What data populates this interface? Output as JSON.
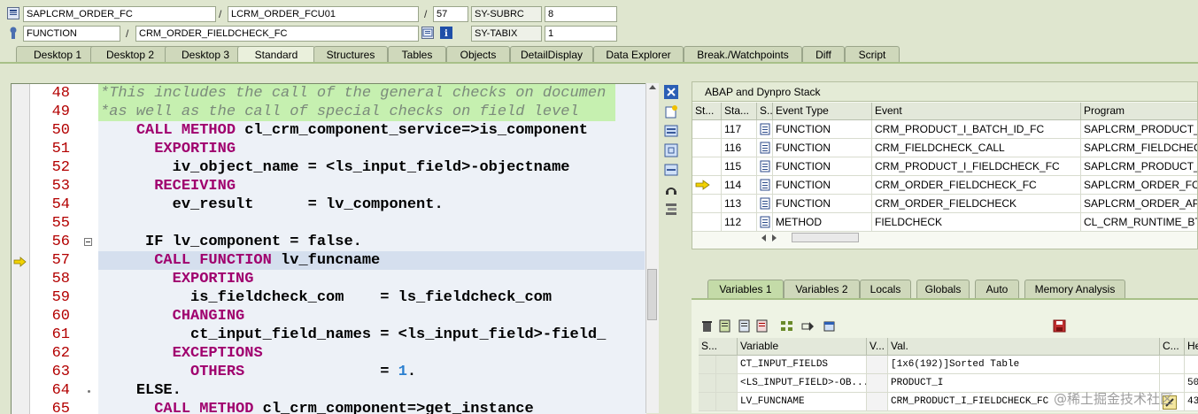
{
  "header": {
    "program": "SAPLCRM_ORDER_FC",
    "include": "LCRM_ORDER_FCU01",
    "line": "57",
    "subrc_label": "SY-SUBRC",
    "subrc_value": "8",
    "event_type": "FUNCTION",
    "event": "CRM_ORDER_FIELDCHECK_FC",
    "tabix_label": "SY-TABIX",
    "tabix_value": "1",
    "sep": "/"
  },
  "tabs": [
    "Desktop 1",
    "Desktop 2",
    "Desktop 3",
    "Standard",
    "Structures",
    "Tables",
    "Objects",
    "DetailDisplay",
    "Data Explorer",
    "Break./Watchpoints",
    "Diff",
    "Script"
  ],
  "code": {
    "lines": [
      {
        "n": "48",
        "parts": [
          [
            "cmt",
            "*This includes the call of the general checks on documen"
          ]
        ]
      },
      {
        "n": "49",
        "parts": [
          [
            "cmt",
            "*as well as the call of special checks on field level"
          ]
        ]
      },
      {
        "n": "50",
        "parts": [
          [
            "tx",
            "    "
          ],
          [
            "kw",
            "CALL METHOD"
          ],
          [
            "tx",
            " cl_crm_component_service=>is_component"
          ]
        ]
      },
      {
        "n": "51",
        "parts": [
          [
            "tx",
            "      "
          ],
          [
            "kw",
            "EXPORTING"
          ]
        ]
      },
      {
        "n": "52",
        "parts": [
          [
            "tx",
            "        iv_object_name = <ls_input_field>-objectname"
          ]
        ]
      },
      {
        "n": "53",
        "parts": [
          [
            "tx",
            "      "
          ],
          [
            "kw",
            "RECEIVING"
          ]
        ]
      },
      {
        "n": "54",
        "parts": [
          [
            "tx",
            "        ev_result      = lv_component."
          ]
        ]
      },
      {
        "n": "55",
        "parts": []
      },
      {
        "n": "56",
        "parts": [
          [
            "tx",
            "     "
          ],
          [
            "kw2",
            "IF"
          ],
          [
            "tx",
            " lv_component = false."
          ]
        ]
      },
      {
        "n": "57",
        "parts": [
          [
            "tx",
            "      "
          ],
          [
            "kw",
            "CALL FUNCTION"
          ],
          [
            "tx",
            " lv_funcname"
          ]
        ]
      },
      {
        "n": "58",
        "parts": [
          [
            "tx",
            "        "
          ],
          [
            "kw",
            "EXPORTING"
          ]
        ]
      },
      {
        "n": "59",
        "parts": [
          [
            "tx",
            "          is_fieldcheck_com    = ls_fieldcheck_com"
          ]
        ]
      },
      {
        "n": "60",
        "parts": [
          [
            "tx",
            "        "
          ],
          [
            "kw",
            "CHANGING"
          ]
        ]
      },
      {
        "n": "61",
        "parts": [
          [
            "tx",
            "          ct_input_field_names = <ls_input_field>-field_"
          ]
        ]
      },
      {
        "n": "62",
        "parts": [
          [
            "tx",
            "        "
          ],
          [
            "kw",
            "EXCEPTIONS"
          ]
        ]
      },
      {
        "n": "63",
        "parts": [
          [
            "tx",
            "          "
          ],
          [
            "kw",
            "OTHERS"
          ],
          [
            "tx",
            "               = "
          ],
          [
            "num",
            "1"
          ],
          [
            "tx",
            "."
          ]
        ]
      },
      {
        "n": "64",
        "parts": [
          [
            "tx",
            "    "
          ],
          [
            "kw2",
            "ELSE."
          ]
        ]
      },
      {
        "n": "65",
        "parts": [
          [
            "tx",
            "      "
          ],
          [
            "kw",
            "CALL METHOD"
          ],
          [
            "tx",
            " cl_crm_component=>get_instance"
          ]
        ]
      }
    ]
  },
  "stack": {
    "title": "ABAP and Dynpro Stack",
    "columns": [
      "St...",
      "Sta...",
      "S...",
      "Event Type",
      "Event",
      "Program"
    ],
    "rows": [
      {
        "level": "117",
        "type": "FUNCTION",
        "event": "CRM_PRODUCT_I_BATCH_ID_FC",
        "program": "SAPLCRM_PRODUCT_I_F"
      },
      {
        "level": "116",
        "type": "FUNCTION",
        "event": "CRM_FIELDCHECK_CALL",
        "program": "SAPLCRM_FIELDCHECK"
      },
      {
        "level": "115",
        "type": "FUNCTION",
        "event": "CRM_PRODUCT_I_FIELDCHECK_FC",
        "program": "SAPLCRM_PRODUCT_I_F"
      },
      {
        "level": "114",
        "type": "FUNCTION",
        "event": "CRM_ORDER_FIELDCHECK_FC",
        "program": "SAPLCRM_ORDER_FC",
        "current": true
      },
      {
        "level": "113",
        "type": "FUNCTION",
        "event": "CRM_ORDER_FIELDCHECK",
        "program": "SAPLCRM_ORDER_API"
      },
      {
        "level": "112",
        "type": "METHOD",
        "event": "FIELDCHECK",
        "program": "CL_CRM_RUNTIME_BTIL"
      }
    ]
  },
  "variables": {
    "tabs": [
      "Variables 1",
      "Variables 2",
      "Locals",
      "Globals",
      "Auto",
      "Memory Analysis"
    ],
    "columns": [
      "S...",
      "Variable",
      "V...",
      "Val.",
      "C...",
      "He"
    ],
    "rows": [
      {
        "name": "CT_INPUT_FIELDS",
        "value": "[1x6(192)]Sorted Table",
        "hex": ""
      },
      {
        "name": "<LS_INPUT_FIELD>-OB...",
        "value": "PRODUCT_I",
        "hex": "50("
      },
      {
        "name": "LV_FUNCNAME",
        "value": "CRM_PRODUCT_I_FIELDCHECK_FC",
        "hex": "43("
      }
    ]
  },
  "watermark": "@稀土掘金技术社区"
}
